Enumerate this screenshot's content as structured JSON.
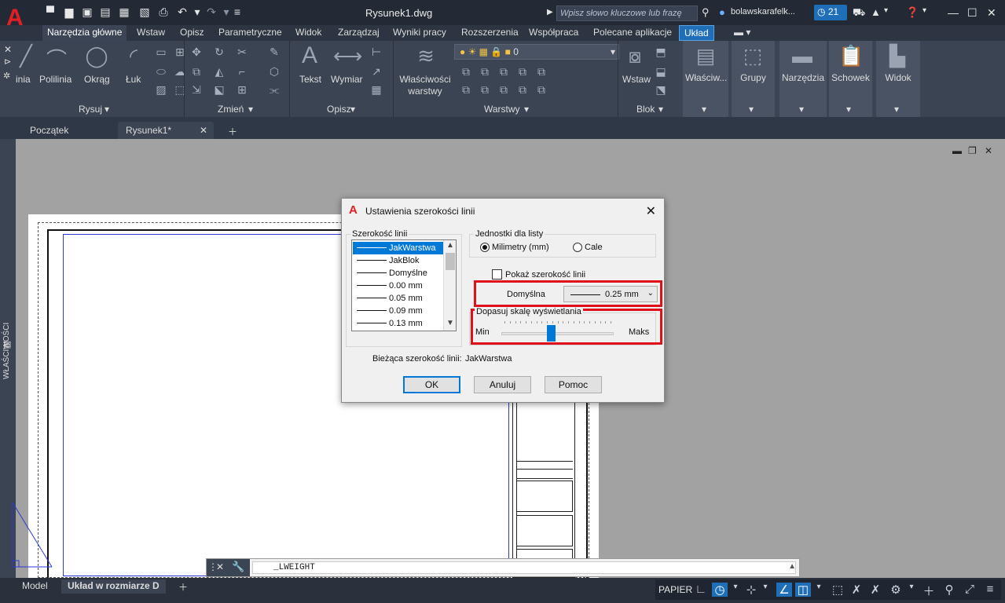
{
  "titlebar": {
    "app_logo": "A",
    "doc_title": "Rysunek1.dwg",
    "search_placeholder": "Wpisz słowo kluczowe lub frazę",
    "user_name": "bolawskarafelk...",
    "notification_count": "21",
    "accent": "#1f6fb8"
  },
  "ribbon_tabs": [
    "Narzędzia główne",
    "Wstaw",
    "Opisz",
    "Parametryczne",
    "Widok",
    "Zarządzaj",
    "Wyniki pracy",
    "Rozszerzenia",
    "Współpraca",
    "Polecane aplikacje",
    "Układ"
  ],
  "ribbon": {
    "draw": {
      "items": [
        "inia",
        "Polilinia",
        "Okrąg",
        "Łuk"
      ],
      "label": "Rysuj"
    },
    "modify": {
      "label": "Zmień"
    },
    "annotate": {
      "items": [
        "Tekst",
        "Wymiar"
      ],
      "label": "Opisz"
    },
    "layers": {
      "props_label": "Właściwości warstwy",
      "current_layer": "0",
      "label": "Warstwy"
    },
    "block": {
      "items": [
        "Wstaw"
      ],
      "label": "Blok"
    },
    "groups": [
      "Właściw...",
      "Grupy",
      "Narzędzia",
      "Schowek",
      "Widok"
    ]
  },
  "doc_tabs": [
    "Początek",
    "Rysunek1*"
  ],
  "left_palette": {
    "properties_tab": "WŁAŚCIWOŚCI"
  },
  "dialog": {
    "title": "Ustawienia szerokości linii",
    "list_group_title": "Szerokość linii",
    "lineweights": [
      "JakWarstwa",
      "JakBlok",
      "Domyślne",
      "0.00 mm",
      "0.05 mm",
      "0.09 mm",
      "0.13 mm"
    ],
    "selected_lineweight": "JakWarstwa",
    "units_group_title": "Jednostki dla listy",
    "unit_mm": "Milimetry (mm)",
    "unit_in": "Cale",
    "unit_selected": "mm",
    "show_lineweight": "Pokaż szerokość linii",
    "show_lineweight_checked": false,
    "default_label": "Domyślna",
    "default_value": "0.25 mm",
    "scale_group_title": "Dopasuj skalę wyświetlania",
    "scale_min": "Min",
    "scale_max": "Maks",
    "scale_level": 0.44,
    "current_label": "Bieżąca szerokość linii:",
    "current_value": "JakWarstwa",
    "ok": "OK",
    "cancel": "Anuluj",
    "help": "Pomoc",
    "highlight_color": "#e0101b"
  },
  "command_line": {
    "text": "_LWEIGHT"
  },
  "status": {
    "tabs": [
      "Model",
      "Układ w rozmiarze D"
    ],
    "active_tab": "Układ w rozmiarze D",
    "paper": "PAPIER"
  }
}
